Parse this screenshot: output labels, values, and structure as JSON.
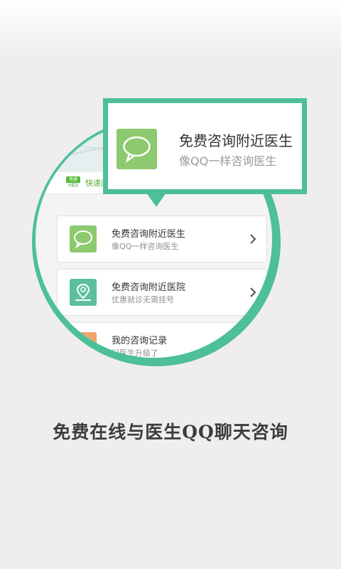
{
  "colors": {
    "accent": "#4dbf99",
    "chat_icon": "#8dc96e",
    "map_icon": "#5cc0a0",
    "record_icon": "#f0a36b"
  },
  "callout": {
    "title": "免费咨询附近医生",
    "subtitle": "像QQ一样咨询医生",
    "icon": "chat-bubble-icon"
  },
  "app_bar": {
    "logo_top": "快速",
    "logo_bottom": "问医生",
    "quick_label": "快速问"
  },
  "menu": [
    {
      "title": "免费咨询附近医生",
      "subtitle": "像QQ一样咨询医生",
      "icon": "chat-bubble-icon"
    },
    {
      "title": "免费咨询附近医院",
      "subtitle": "优惠就诊无需挂号",
      "icon": "map-pin-icon"
    },
    {
      "title": "我的咨询记录",
      "subtitle": "问医生升级了",
      "icon": "record-icon"
    }
  ],
  "tagline": "免费在线与医生QQ聊天咨询"
}
